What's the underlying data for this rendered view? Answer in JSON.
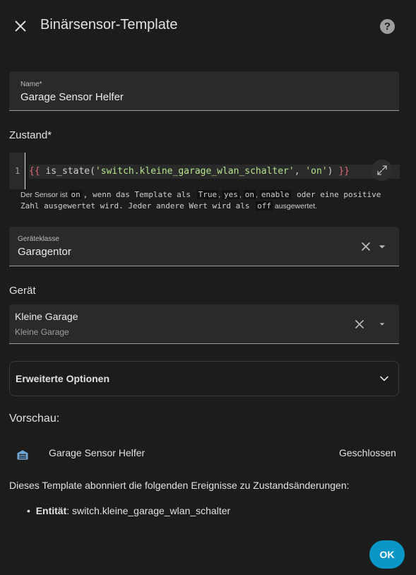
{
  "dialog": {
    "title": "Binärsensor-Template",
    "close_icon": "close-icon",
    "help_icon": "help-circle-icon",
    "help_glyph": "?"
  },
  "name_field": {
    "label": "Name*",
    "value": "Garage Sensor Helfer"
  },
  "state_section": {
    "label": "Zustand*",
    "line_number": "1",
    "code": {
      "open": "{{ ",
      "fn": "is_state(",
      "arg1": "'switch.kleine_garage_wlan_schalter'",
      "sep": ", ",
      "arg2": "'on'",
      "close_paren": ")",
      "close": " }}"
    },
    "expand_icon": "expand-icon",
    "helper": {
      "p1": "Der Sensor ist ",
      "v1": "on",
      "p2": ", wenn das Template als ",
      "v2": "True",
      "p3": ", ",
      "v3": "yes",
      "p4": ", ",
      "v4": "on",
      "p5": ", ",
      "v5": "enable",
      "p6": " oder eine positive Zahl ausgewertet wird. Jeder andere Wert wird als ",
      "v6": "off",
      "p7": " ausgewertet."
    }
  },
  "device_class_field": {
    "label": "Geräteklasse",
    "value": "Garagentor"
  },
  "device_section": {
    "label": "Gerät",
    "value": "Kleine Garage",
    "secondary": "Kleine Garage"
  },
  "advanced": {
    "label": "Erweiterte Optionen",
    "icon": "chevron-down-icon"
  },
  "preview": {
    "title": "Vorschau:",
    "entity_icon": "garage-icon",
    "entity_name": "Garage Sensor Helfer",
    "entity_state": "Geschlossen",
    "subscription_text": "Dieses Template abonniert die folgenden Ereignisse zu Zustandsänderungen:",
    "bullet_label": "Entität",
    "bullet_value": ": switch.kleine_garage_wlan_schalter"
  },
  "actions": {
    "ok_label": "OK"
  }
}
